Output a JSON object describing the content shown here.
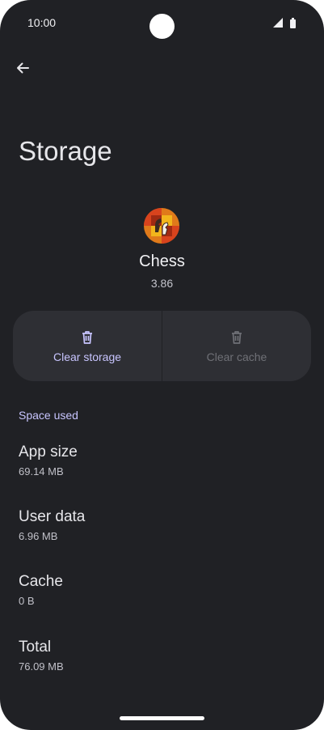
{
  "status_bar": {
    "time": "10:00"
  },
  "header": {
    "title": "Storage"
  },
  "app": {
    "name": "Chess",
    "version": "3.86"
  },
  "actions": {
    "clear_storage": {
      "label": "Clear storage",
      "enabled": true
    },
    "clear_cache": {
      "label": "Clear cache",
      "enabled": false
    }
  },
  "space_used": {
    "header": "Space used",
    "items": [
      {
        "label": "App size",
        "value": "69.14 MB"
      },
      {
        "label": "User data",
        "value": "6.96 MB"
      },
      {
        "label": "Cache",
        "value": "0 B"
      },
      {
        "label": "Total",
        "value": "76.09 MB"
      }
    ]
  },
  "colors": {
    "background": "#202125",
    "card": "#2e2f34",
    "accent": "#c8c5ff",
    "disabled": "#6f7076"
  }
}
